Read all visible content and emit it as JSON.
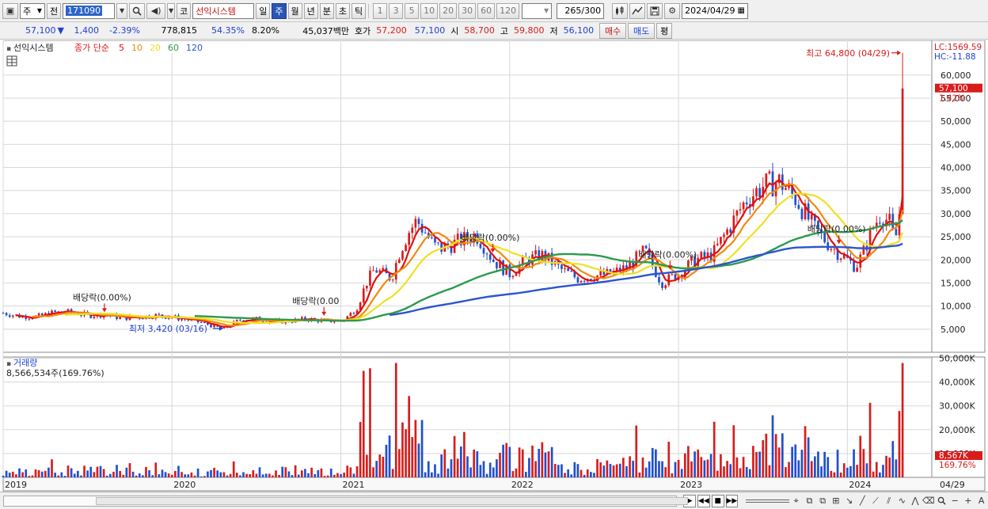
{
  "toolbar1": {
    "period_select": "주",
    "prev_label": "전",
    "code_value": "171090",
    "code_type": "코",
    "stock_name": "선익시스템",
    "periods": [
      "일",
      "주",
      "월",
      "년",
      "분",
      "초",
      "틱"
    ],
    "active_period": "주",
    "numbers": [
      "1",
      "3",
      "5",
      "10",
      "20",
      "30",
      "60",
      "120"
    ],
    "count": "265",
    "count_total": "/300",
    "date": "2024/04/29"
  },
  "toolbar2": {
    "price": "57,100",
    "change": "1,400",
    "change_pct": "-2.39%",
    "volume": "778,815",
    "volume_ratio": "54.35%",
    "turnover": "8.20%",
    "amount": "45,037백만",
    "hoga_label": "호가",
    "ask": "57,200",
    "bid": "57,100",
    "open_label": "시",
    "open": "58,700",
    "high_label": "고",
    "high": "59,800",
    "low_label": "저",
    "low": "56,100",
    "buy_label": "매수",
    "sell_label": "매도",
    "eval_label": "평"
  },
  "chart": {
    "legend_name": "선익시스템",
    "legend_type": "종가 단순",
    "ma_periods": [
      "5",
      "10",
      "20",
      "60",
      "120"
    ],
    "ma_colors": [
      "#e01010",
      "#f08a10",
      "#f0e020",
      "#2c9a4c",
      "#2a55d0"
    ],
    "lc_label": "LC:1569.59",
    "hc_label": "HC:-11.88",
    "current_price_label": "57,100",
    "current_pct_label": "1.42%",
    "high_annotation": "최고 64,800 (04/29)",
    "low_annotation": "최저 3,420 (03/16)",
    "dividend_label": "배당락(0.00%)",
    "dividend_label_short": "배당락(0.00",
    "volume_title": "거래량",
    "volume_value": "8,566,534주(169.76%)",
    "volume_marker": "8,567K",
    "volume_marker_pct": "169.76%",
    "x_end_label": "04/29",
    "colors": {
      "up": "#d81c1c",
      "down": "#1f4fd0",
      "grid": "#d8d8d8"
    }
  },
  "chart_data": {
    "type": "candlestick",
    "title": "",
    "price_ticks": [
      "60,000",
      "55,000",
      "50,000",
      "45,000",
      "40,000",
      "35,000",
      "30,000",
      "25,000",
      "20,000",
      "15,000",
      "10,000",
      "5,000"
    ],
    "price_tick_values": [
      60000,
      55000,
      50000,
      45000,
      40000,
      35000,
      30000,
      25000,
      20000,
      15000,
      10000,
      5000
    ],
    "price_ylim": [
      0,
      67500
    ],
    "volume_ticks": [
      "50,000K",
      "40,000K",
      "30,000K",
      "20,000K",
      "10,000K"
    ],
    "volume_tick_values": [
      50000,
      40000,
      30000,
      20000,
      10000
    ],
    "volume_ylim": [
      0,
      50500
    ],
    "x_labels": [
      "2019",
      "2020",
      "2021",
      "2022",
      "2023",
      "2024"
    ],
    "x_label_years": [
      2019.0,
      2020.0,
      2021.0,
      2022.0,
      2023.0,
      2024.0
    ],
    "xlim": [
      2019.0,
      2024.5
    ],
    "close_series": {
      "t": [
        2019.0,
        2019.1,
        2019.2,
        2019.3,
        2019.4,
        2019.5,
        2019.6,
        2019.7,
        2019.8,
        2019.9,
        2020.0,
        2020.1,
        2020.2,
        2020.3,
        2020.4,
        2020.5,
        2020.6,
        2020.7,
        2020.8,
        2020.9,
        2021.0,
        2021.05,
        2021.1,
        2021.15,
        2021.2,
        2021.25,
        2021.3,
        2021.35,
        2021.4,
        2021.45,
        2021.5,
        2021.55,
        2021.6,
        2021.7,
        2021.8,
        2021.85,
        2021.9,
        2022.0,
        2022.1,
        2022.2,
        2022.3,
        2022.4,
        2022.5,
        2022.6,
        2022.7,
        2022.8,
        2022.9,
        2023.0,
        2023.1,
        2023.2,
        2023.3,
        2023.4,
        2023.5,
        2023.6,
        2023.7,
        2023.8,
        2023.9,
        2024.0,
        2024.05,
        2024.1,
        2024.15,
        2024.2,
        2024.25,
        2024.28,
        2024.3,
        2024.33
      ],
      "close": [
        8500,
        7800,
        7700,
        8600,
        8700,
        8000,
        8200,
        7400,
        7600,
        8000,
        7600,
        7000,
        6200,
        5000,
        7000,
        7200,
        6600,
        6800,
        7200,
        6800,
        6800,
        8000,
        10000,
        15000,
        18000,
        17000,
        16000,
        22000,
        26000,
        28500,
        26000,
        23000,
        22500,
        24000,
        25500,
        23000,
        20000,
        17000,
        20000,
        21000,
        18000,
        16000,
        16500,
        17000,
        18500,
        22000,
        15000,
        17000,
        20000,
        21000,
        27000,
        33000,
        36000,
        37000,
        33000,
        27000,
        23000,
        20000,
        18500,
        22000,
        27000,
        30000,
        28000,
        24000,
        27000,
        39000,
        37000,
        41000,
        57100
      ]
    },
    "series": [
      {
        "name": "5",
        "color": "#e01010"
      },
      {
        "name": "10",
        "color": "#f08a10"
      },
      {
        "name": "20",
        "color": "#f0e020"
      },
      {
        "name": "60",
        "color": "#2c9a4c"
      },
      {
        "name": "120",
        "color": "#2a55d0"
      }
    ],
    "extremes": {
      "high": 64800,
      "high_date": "04/29",
      "low": 3420,
      "low_date": "03/16"
    },
    "dividend_dates": [
      2019.6,
      2020.9,
      2021.9,
      2022.95,
      2023.95
    ]
  }
}
